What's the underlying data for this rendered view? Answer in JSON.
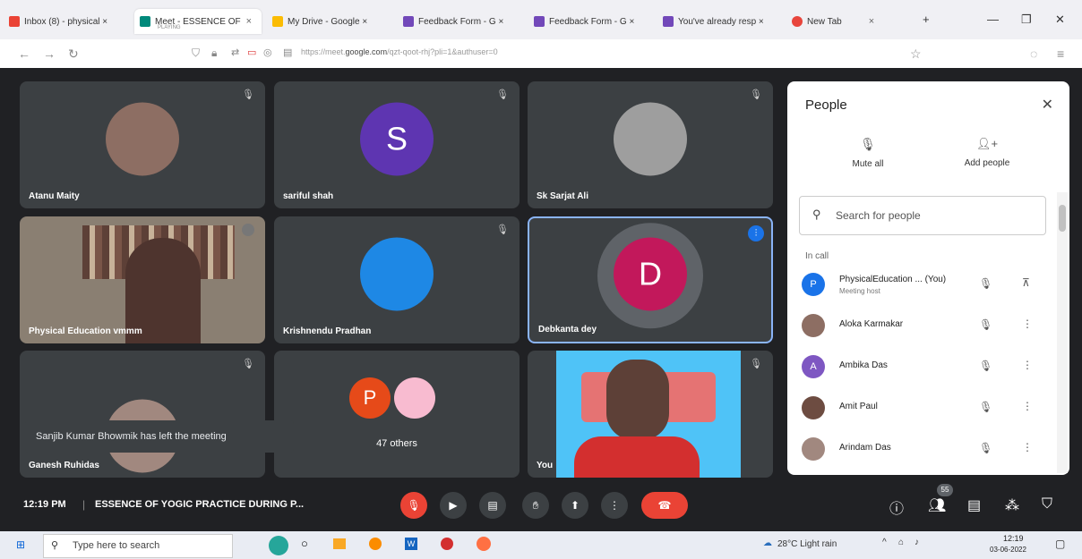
{
  "tabs": [
    {
      "label": "Inbox (8) - physical ×",
      "color": "#ea4335"
    },
    {
      "label": "Meet - ESSENCE OF",
      "sub": "PLAYING",
      "color": "#00897b"
    },
    {
      "label": "My Drive - Google ×",
      "color": "#fbbc04"
    },
    {
      "label": "Feedback Form - G ×",
      "color": "#7248b9"
    },
    {
      "label": "Feedback Form - G ×",
      "color": "#7248b9"
    },
    {
      "label": "You've already resp ×",
      "color": "#7248b9"
    },
    {
      "label": "New Tab",
      "color": "#e8453c"
    }
  ],
  "url": {
    "prefix": "https://meet.",
    "host": "google.com",
    "path": "/qzt-qoot-rhj?pli=1&authuser=0"
  },
  "tiles": [
    {
      "name": "Atanu Maity",
      "avatar_color": "#8d6e63",
      "initial": ""
    },
    {
      "name": "sariful shah",
      "avatar_color": "#5e35b1",
      "initial": "S"
    },
    {
      "name": "Sk Sarjat Ali",
      "avatar_color": "#9e9e9e",
      "initial": ""
    },
    {
      "name": "Physical Education vmmm",
      "avatar_color": "#6d4c41",
      "initial": ""
    },
    {
      "name": "Krishnendu Pradhan",
      "avatar_color": "#1e88e5",
      "initial": ""
    },
    {
      "name": "Debkanta dey",
      "avatar_color": "#c2185b",
      "initial": "D"
    },
    {
      "name": "Ganesh Ruhidas",
      "avatar_color": "#a1887f",
      "initial": ""
    },
    {
      "name": "47 others",
      "avatar_color": "#e64a19",
      "initial": "P"
    },
    {
      "name": "You",
      "avatar_color": "#4fc3f7",
      "initial": ""
    }
  ],
  "toast": "Sanjib Kumar Bhowmik has left the meeting",
  "people": {
    "title": "People",
    "mute_all": "Mute all",
    "add_people": "Add people",
    "search_placeholder": "Search for people",
    "in_call": "In call",
    "members": [
      {
        "name": "PhysicalEducation ... (You)",
        "role": "Meeting host",
        "color": "#1a73e8",
        "initial": "P"
      },
      {
        "name": "Aloka Karmakar",
        "color": "#8d6e63",
        "initial": ""
      },
      {
        "name": "Ambika Das",
        "color": "#7e57c2",
        "initial": "A"
      },
      {
        "name": "Amit Paul",
        "color": "#6d4c41",
        "initial": ""
      },
      {
        "name": "Arindam Das",
        "color": "#a1887f",
        "initial": ""
      }
    ]
  },
  "meeting": {
    "time": "12:19 PM",
    "title": "ESSENCE OF YOGIC PRACTICE DURING P...",
    "participants_badge": "55"
  },
  "taskbar": {
    "search": "Type here to search",
    "weather": "28°C  Light rain",
    "clock_time": "12:19",
    "clock_date": "03-06-2022"
  }
}
